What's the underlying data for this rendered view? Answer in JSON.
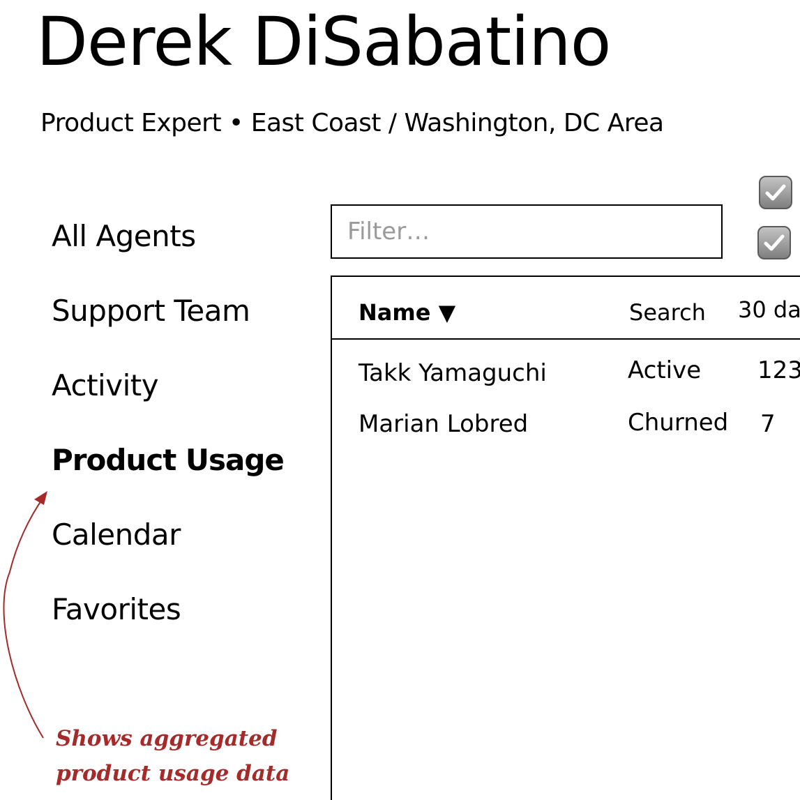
{
  "header": {
    "title": "Derek DiSabatino",
    "subtitle": "Product Expert • East Coast / Washington, DC Area"
  },
  "sidebar": {
    "items": [
      {
        "label": "All Agents",
        "active": false
      },
      {
        "label": "Support Team",
        "active": false
      },
      {
        "label": "Activity",
        "active": false
      },
      {
        "label": "Product Usage",
        "active": true
      },
      {
        "label": "Calendar",
        "active": false
      },
      {
        "label": "Favorites",
        "active": false
      }
    ]
  },
  "filter": {
    "placeholder": "Filter…",
    "value": ""
  },
  "checkboxes": [
    {
      "checked": true
    },
    {
      "checked": true
    }
  ],
  "table": {
    "columns": [
      "Name ▼",
      "Search",
      "30 da"
    ],
    "rows": [
      [
        "Takk Yamaguchi",
        "Active",
        "123"
      ],
      [
        "Marian Lobred",
        "Churned",
        "7"
      ]
    ]
  },
  "annotation": {
    "lines": [
      "Shows aggregated",
      "product usage data"
    ],
    "color": "#a52a2a"
  }
}
